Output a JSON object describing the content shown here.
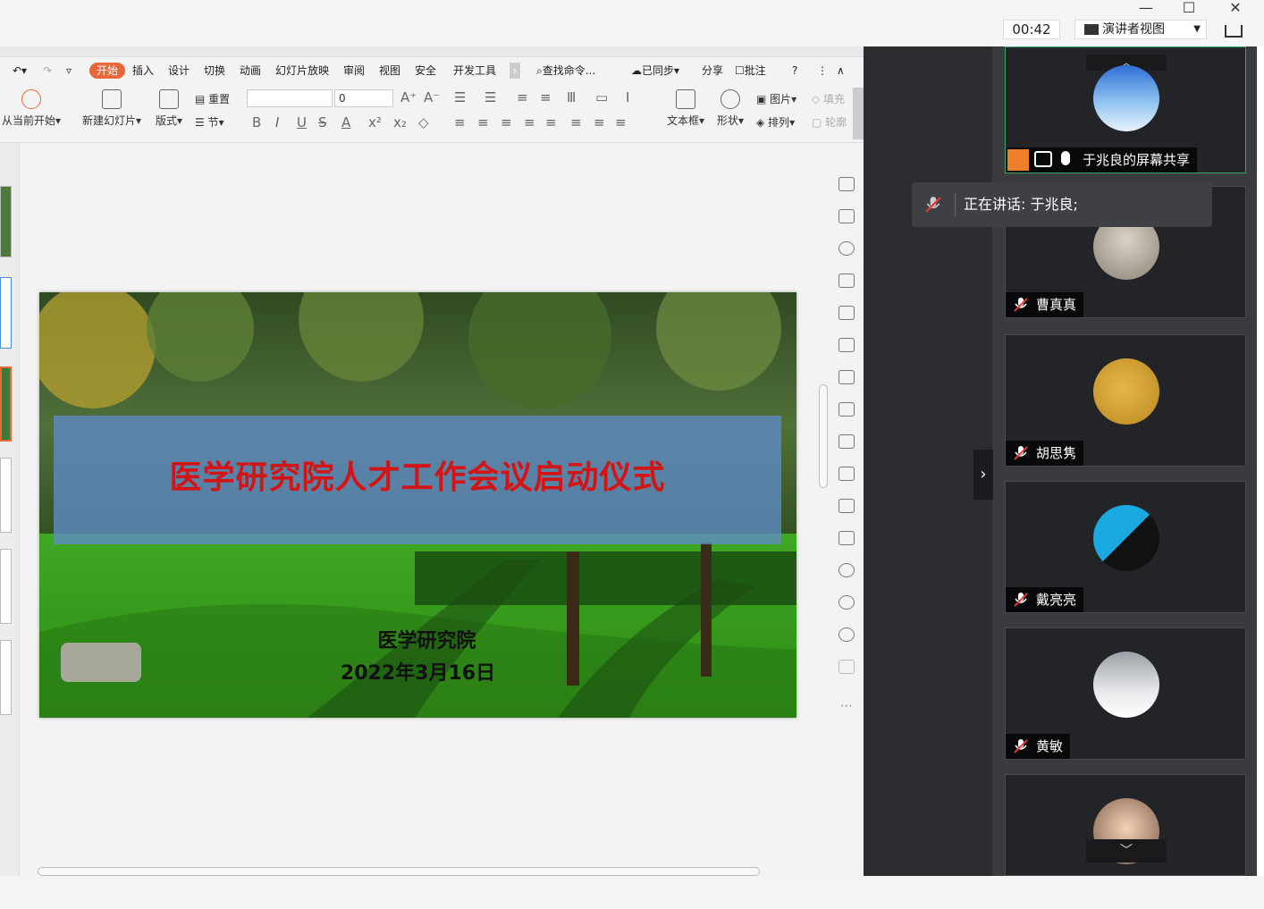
{
  "window": {
    "timer": "00:42",
    "presenter_view": "演讲者视图",
    "minimize": "—",
    "maximize": "☐",
    "close": "✕"
  },
  "menu": {
    "items": [
      "开始",
      "插入",
      "设计",
      "切换",
      "动画",
      "幻灯片放映",
      "审阅",
      "视图",
      "安全",
      "开发工具"
    ],
    "search": "查找命令...",
    "sync": "已同步",
    "share": "分享",
    "comment": "批注",
    "help": "?"
  },
  "ribbon": {
    "from_current": "从当前开始",
    "new_slide": "新建幻灯片",
    "layout": "版式",
    "reset": "重置",
    "section": "节",
    "font_size": "0",
    "textbox": "文本框",
    "shape": "形状",
    "picture": "图片",
    "fill": "填充",
    "arrange": "排列",
    "outline": "轮廓",
    "format_buttons": [
      "B",
      "I",
      "U",
      "S",
      "A"
    ]
  },
  "slide": {
    "title": "医学研究院人才工作会议启动仪式",
    "org": "医学研究院",
    "date": "2022年3月16日"
  },
  "meeting": {
    "screen_share": "于兆良的屏幕共享",
    "speaking": "正在讲话: 于兆良;",
    "participants": [
      {
        "name": "曹真真"
      },
      {
        "name": "胡思隽"
      },
      {
        "name": "戴亮亮"
      },
      {
        "name": "黄敏"
      }
    ]
  },
  "colors": {
    "accent": "#e8683a",
    "slide_title": "#d41414",
    "panel_bg": "#2c2d30",
    "active_tile": "#3aa86b"
  }
}
